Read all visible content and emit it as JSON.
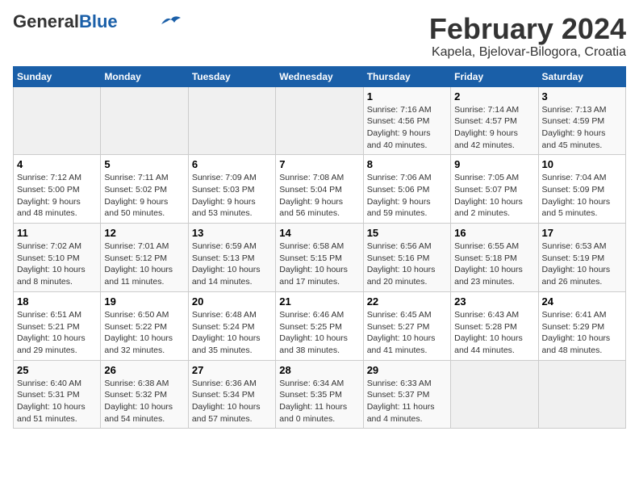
{
  "header": {
    "logo_general": "General",
    "logo_blue": "Blue",
    "title": "February 2024",
    "subtitle": "Kapela, Bjelovar-Bilogora, Croatia"
  },
  "columns": [
    "Sunday",
    "Monday",
    "Tuesday",
    "Wednesday",
    "Thursday",
    "Friday",
    "Saturday"
  ],
  "weeks": [
    [
      {
        "day": "",
        "info": ""
      },
      {
        "day": "",
        "info": ""
      },
      {
        "day": "",
        "info": ""
      },
      {
        "day": "",
        "info": ""
      },
      {
        "day": "1",
        "info": "Sunrise: 7:16 AM\nSunset: 4:56 PM\nDaylight: 9 hours\nand 40 minutes."
      },
      {
        "day": "2",
        "info": "Sunrise: 7:14 AM\nSunset: 4:57 PM\nDaylight: 9 hours\nand 42 minutes."
      },
      {
        "day": "3",
        "info": "Sunrise: 7:13 AM\nSunset: 4:59 PM\nDaylight: 9 hours\nand 45 minutes."
      }
    ],
    [
      {
        "day": "4",
        "info": "Sunrise: 7:12 AM\nSunset: 5:00 PM\nDaylight: 9 hours\nand 48 minutes."
      },
      {
        "day": "5",
        "info": "Sunrise: 7:11 AM\nSunset: 5:02 PM\nDaylight: 9 hours\nand 50 minutes."
      },
      {
        "day": "6",
        "info": "Sunrise: 7:09 AM\nSunset: 5:03 PM\nDaylight: 9 hours\nand 53 minutes."
      },
      {
        "day": "7",
        "info": "Sunrise: 7:08 AM\nSunset: 5:04 PM\nDaylight: 9 hours\nand 56 minutes."
      },
      {
        "day": "8",
        "info": "Sunrise: 7:06 AM\nSunset: 5:06 PM\nDaylight: 9 hours\nand 59 minutes."
      },
      {
        "day": "9",
        "info": "Sunrise: 7:05 AM\nSunset: 5:07 PM\nDaylight: 10 hours\nand 2 minutes."
      },
      {
        "day": "10",
        "info": "Sunrise: 7:04 AM\nSunset: 5:09 PM\nDaylight: 10 hours\nand 5 minutes."
      }
    ],
    [
      {
        "day": "11",
        "info": "Sunrise: 7:02 AM\nSunset: 5:10 PM\nDaylight: 10 hours\nand 8 minutes."
      },
      {
        "day": "12",
        "info": "Sunrise: 7:01 AM\nSunset: 5:12 PM\nDaylight: 10 hours\nand 11 minutes."
      },
      {
        "day": "13",
        "info": "Sunrise: 6:59 AM\nSunset: 5:13 PM\nDaylight: 10 hours\nand 14 minutes."
      },
      {
        "day": "14",
        "info": "Sunrise: 6:58 AM\nSunset: 5:15 PM\nDaylight: 10 hours\nand 17 minutes."
      },
      {
        "day": "15",
        "info": "Sunrise: 6:56 AM\nSunset: 5:16 PM\nDaylight: 10 hours\nand 20 minutes."
      },
      {
        "day": "16",
        "info": "Sunrise: 6:55 AM\nSunset: 5:18 PM\nDaylight: 10 hours\nand 23 minutes."
      },
      {
        "day": "17",
        "info": "Sunrise: 6:53 AM\nSunset: 5:19 PM\nDaylight: 10 hours\nand 26 minutes."
      }
    ],
    [
      {
        "day": "18",
        "info": "Sunrise: 6:51 AM\nSunset: 5:21 PM\nDaylight: 10 hours\nand 29 minutes."
      },
      {
        "day": "19",
        "info": "Sunrise: 6:50 AM\nSunset: 5:22 PM\nDaylight: 10 hours\nand 32 minutes."
      },
      {
        "day": "20",
        "info": "Sunrise: 6:48 AM\nSunset: 5:24 PM\nDaylight: 10 hours\nand 35 minutes."
      },
      {
        "day": "21",
        "info": "Sunrise: 6:46 AM\nSunset: 5:25 PM\nDaylight: 10 hours\nand 38 minutes."
      },
      {
        "day": "22",
        "info": "Sunrise: 6:45 AM\nSunset: 5:27 PM\nDaylight: 10 hours\nand 41 minutes."
      },
      {
        "day": "23",
        "info": "Sunrise: 6:43 AM\nSunset: 5:28 PM\nDaylight: 10 hours\nand 44 minutes."
      },
      {
        "day": "24",
        "info": "Sunrise: 6:41 AM\nSunset: 5:29 PM\nDaylight: 10 hours\nand 48 minutes."
      }
    ],
    [
      {
        "day": "25",
        "info": "Sunrise: 6:40 AM\nSunset: 5:31 PM\nDaylight: 10 hours\nand 51 minutes."
      },
      {
        "day": "26",
        "info": "Sunrise: 6:38 AM\nSunset: 5:32 PM\nDaylight: 10 hours\nand 54 minutes."
      },
      {
        "day": "27",
        "info": "Sunrise: 6:36 AM\nSunset: 5:34 PM\nDaylight: 10 hours\nand 57 minutes."
      },
      {
        "day": "28",
        "info": "Sunrise: 6:34 AM\nSunset: 5:35 PM\nDaylight: 11 hours\nand 0 minutes."
      },
      {
        "day": "29",
        "info": "Sunrise: 6:33 AM\nSunset: 5:37 PM\nDaylight: 11 hours\nand 4 minutes."
      },
      {
        "day": "",
        "info": ""
      },
      {
        "day": "",
        "info": ""
      }
    ]
  ]
}
